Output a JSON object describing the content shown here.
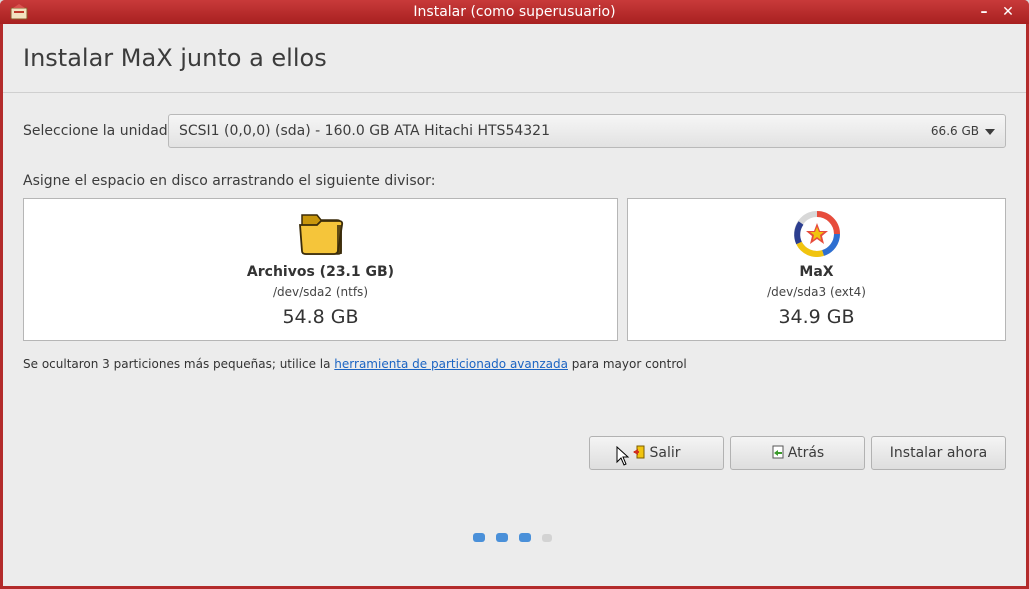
{
  "window": {
    "title": "Instalar (como superusuario)",
    "minimize_glyph": "–",
    "close_glyph": "✕",
    "accent_color": "#b32b2b"
  },
  "page": {
    "title": "Instalar MaX junto a ellos"
  },
  "unit": {
    "label": "Seleccione la unidad:",
    "selected": "SCSI1 (0,0,0) (sda) - 160.0 GB ATA Hitachi HTS54321",
    "size": "66.6 GB"
  },
  "assign": {
    "label": "Asigne el espacio en disco arrastrando el siguiente divisor:"
  },
  "partitions": [
    {
      "name": "Archivos (23.1 GB)",
      "device": "/dev/sda2 (ntfs)",
      "size": "54.8 GB",
      "icon": "folder-icon"
    },
    {
      "name": "MaX",
      "device": "/dev/sda3 (ext4)",
      "size": "34.9 GB",
      "icon": "max-logo-icon"
    }
  ],
  "hidden_note": {
    "before": "Se ocultaron 3 particiones más pequeñas; utilice la ",
    "link": "herramienta de particionado avanzada",
    "after": " para mayor control"
  },
  "buttons": {
    "quit": "Salir",
    "back": "Atrás",
    "install": "Instalar ahora"
  },
  "steps": {
    "total": 4,
    "completed": 3,
    "active_color": "#4a90d9",
    "inactive_color": "#d3d3d3"
  }
}
